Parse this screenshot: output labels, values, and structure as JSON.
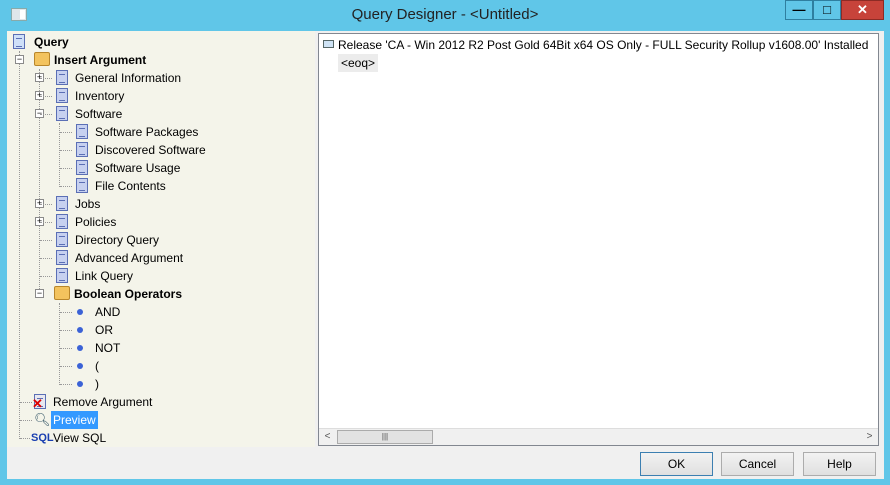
{
  "window": {
    "title": "Query Designer - <Untitled>",
    "minimize": "—",
    "maximize": "□",
    "close": "✕"
  },
  "tree": {
    "root": "Query",
    "insert_argument": "Insert Argument",
    "items": [
      {
        "label": "General Information",
        "expander": "+"
      },
      {
        "label": "Inventory",
        "expander": "+"
      },
      {
        "label": "Software",
        "expander": "−"
      },
      {
        "label": "Software Packages"
      },
      {
        "label": "Discovered Software"
      },
      {
        "label": "Software Usage"
      },
      {
        "label": "File Contents"
      },
      {
        "label": "Jobs",
        "expander": "+"
      },
      {
        "label": "Policies",
        "expander": "+"
      },
      {
        "label": "Directory Query"
      },
      {
        "label": "Advanced Argument"
      },
      {
        "label": "Link Query"
      }
    ],
    "boolean_operators": "Boolean Operators",
    "operators": [
      "AND",
      "OR",
      "NOT",
      "(",
      ")"
    ],
    "remove_argument": "Remove Argument",
    "preview": "Preview",
    "view_sql": "View SQL",
    "sql_icon_text": "SQL"
  },
  "preview": {
    "line": "Release 'CA - Win 2012 R2 Post Gold 64Bit x64 OS Only - FULL Security Rollup v1608.00' Installed",
    "eoq": "<eoq>"
  },
  "buttons": {
    "ok": "OK",
    "cancel": "Cancel",
    "help": "Help"
  }
}
